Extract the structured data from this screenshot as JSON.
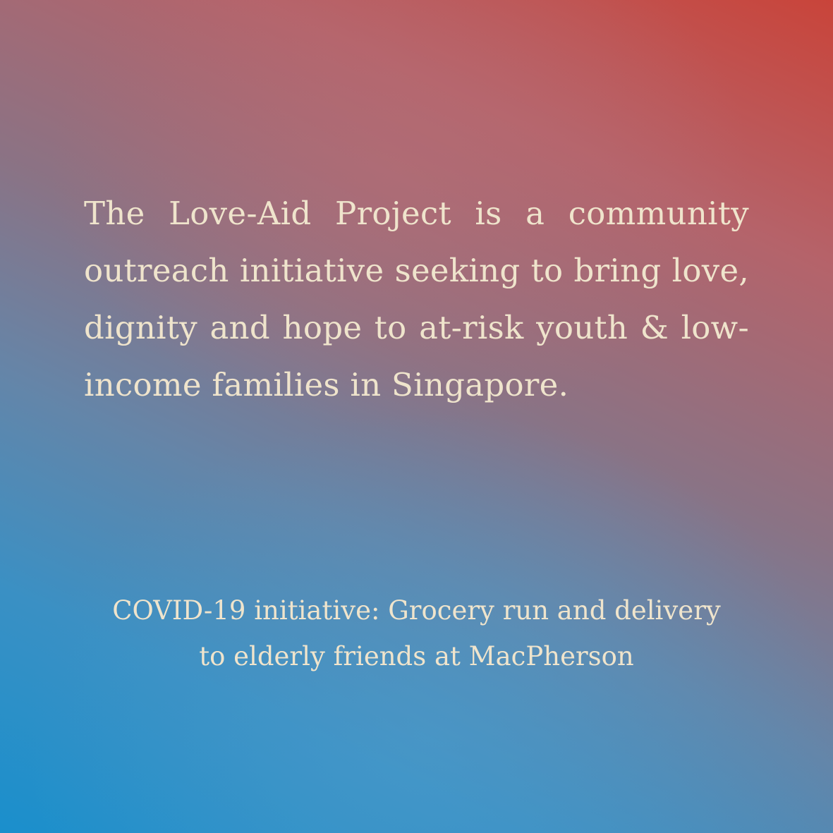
{
  "background": {
    "gradient_colors": [
      "#c9443a",
      "#b5636a",
      "#8a7385",
      "#6585a8",
      "#3a90c4",
      "#1a8fcc"
    ]
  },
  "text_color": "#efe4cc",
  "description": "The Love-Aid Project is a community outreach initiative seeking to bring love, dignity and hope to at-risk youth & low-income families in Singapore.",
  "covid_note": {
    "line1": "COVID-19 initiative: Grocery run and delivery",
    "line2": "to elderly friends at MacPherson"
  }
}
